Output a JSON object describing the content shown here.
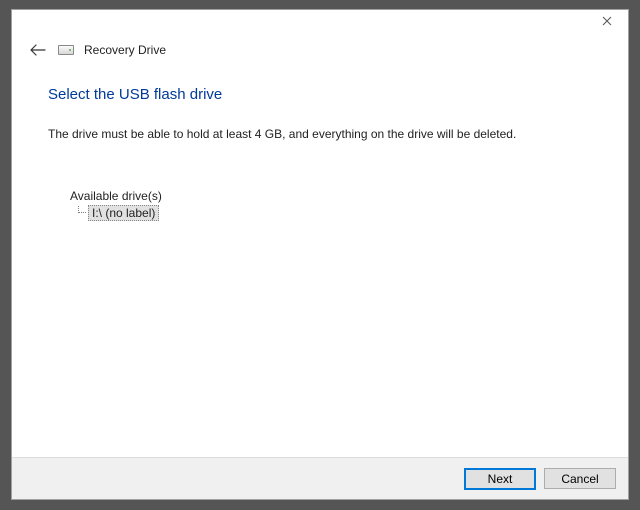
{
  "window": {
    "title": "Recovery Drive"
  },
  "page": {
    "heading": "Select the USB flash drive",
    "description": "The drive must be able to hold at least 4 GB, and everything on the drive will be deleted."
  },
  "drives": {
    "label": "Available drive(s)",
    "items": [
      {
        "label": "I:\\ (no label)"
      }
    ]
  },
  "buttons": {
    "next": "Next",
    "cancel": "Cancel"
  }
}
